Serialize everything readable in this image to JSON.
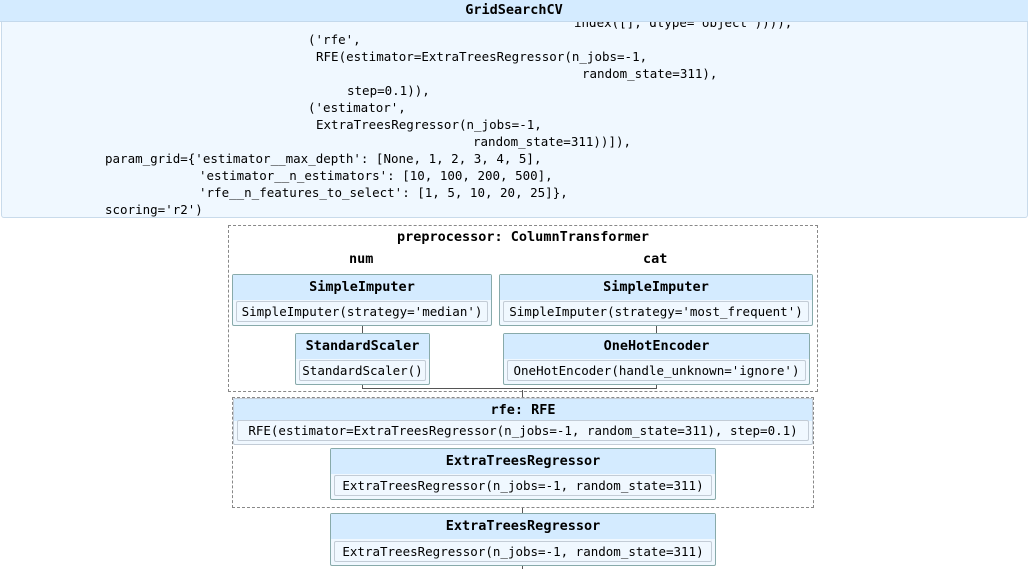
{
  "gridsearch": {
    "title": "GridSearchCV",
    "code_lines": [
      "index([], dtype='object')))),",
      "('rfe',",
      "RFE(estimator=ExtraTreesRegressor(n_jobs=-1,",
      "random_state=311),",
      "step=0.1)),",
      "('estimator',",
      "ExtraTreesRegressor(n_jobs=-1,",
      "random_state=311))]),",
      "param_grid={'estimator__max_depth': [None, 1, 2, 3, 4, 5],",
      "'estimator__n_estimators': [10, 100, 200, 500],",
      "'rfe__n_features_to_select': [1, 5, 10, 20, 25]},",
      "scoring='r2')"
    ]
  },
  "preprocessor": {
    "title": "preprocessor: ColumnTransformer",
    "num": {
      "label": "num",
      "imputer": {
        "name": "SimpleImputer",
        "params": "SimpleImputer(strategy='median')"
      },
      "scaler": {
        "name": "StandardScaler",
        "params": "StandardScaler()"
      }
    },
    "cat": {
      "label": "cat",
      "imputer": {
        "name": "SimpleImputer",
        "params": "SimpleImputer(strategy='most_frequent')"
      },
      "encoder": {
        "name": "OneHotEncoder",
        "params": "OneHotEncoder(handle_unknown='ignore')"
      }
    }
  },
  "rfe": {
    "title": "rfe: RFE",
    "params": "RFE(estimator=ExtraTreesRegressor(n_jobs=-1, random_state=311), step=0.1)",
    "inner": {
      "name": "ExtraTreesRegressor",
      "params": "ExtraTreesRegressor(n_jobs=-1, random_state=311)"
    }
  },
  "estimator": {
    "name": "ExtraTreesRegressor",
    "params": "ExtraTreesRegressor(n_jobs=-1, random_state=311)"
  },
  "colors": {
    "header_bg": "#d4ebff",
    "panel_bg": "#f0f8ff"
  }
}
